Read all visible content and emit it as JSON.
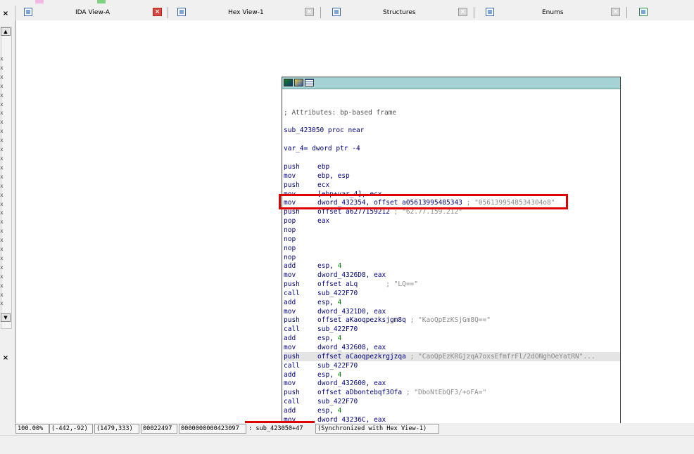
{
  "tabs": [
    {
      "label": "IDA View-A",
      "active": true
    },
    {
      "label": "Hex View-1",
      "active": false
    },
    {
      "label": "Structures",
      "active": false
    },
    {
      "label": "Enums",
      "active": false
    }
  ],
  "left_panel": {
    "close_glyph": "×",
    "scroll_up_glyph": "▲",
    "scroll_down_glyph": "▼",
    "x_markers": "x\nx\nx\nx\nx\nx\nx\nx\nx\nx\nx\nx\nx\nx\nx\nx\nx\nx\nx\nx\nx\nx\nx\nx\nx\nx\nx\nx"
  },
  "listing": {
    "attributes_comment": "; Attributes: bp-based frame",
    "proc_line": "sub_423050 proc near",
    "var_line": "var_4= dword ptr -4",
    "instructions": [
      {
        "m": "push",
        "o": "ebp",
        "c": ""
      },
      {
        "m": "mov",
        "o": "ebp, esp",
        "c": ""
      },
      {
        "m": "push",
        "o": "ecx",
        "c": ""
      },
      {
        "m": "mov",
        "o": "[ebp+var_4], ecx",
        "c": ""
      },
      {
        "m": "mov",
        "o": "dword_432354, offset a05613995485343",
        "c": " ; \"0561399548534304o8\""
      },
      {
        "m": "push",
        "o": "offset a6277159212",
        "c": " ; \"62.77.159.212\""
      },
      {
        "m": "pop",
        "o": "eax",
        "c": ""
      },
      {
        "m": "nop",
        "o": "",
        "c": ""
      },
      {
        "m": "nop",
        "o": "",
        "c": ""
      },
      {
        "m": "nop",
        "o": "",
        "c": ""
      },
      {
        "m": "nop",
        "o": "",
        "c": ""
      },
      {
        "m": "add",
        "o": "esp, 4",
        "c": ""
      },
      {
        "m": "mov",
        "o": "dword_4326D8, eax",
        "c": ""
      },
      {
        "m": "push",
        "o": "offset aLq",
        "c": "       ; \"LQ==\""
      },
      {
        "m": "call",
        "o": "sub_422F70",
        "c": ""
      },
      {
        "m": "add",
        "o": "esp, 4",
        "c": ""
      },
      {
        "m": "mov",
        "o": "dword_4321D0, eax",
        "c": ""
      },
      {
        "m": "push",
        "o": "offset aKaoqpezksjgm8q",
        "c": " ; \"KaoQpEzKSjGm8Q==\""
      },
      {
        "m": "call",
        "o": "sub_422F70",
        "c": ""
      },
      {
        "m": "add",
        "o": "esp, 4",
        "c": ""
      },
      {
        "m": "mov",
        "o": "dword_432608, eax",
        "c": ""
      },
      {
        "m": "push",
        "o": "offset aCaoqpezkrgjzqa",
        "c": " ; \"CaoQpEzKRGjzqA7oxsEfmfrFl/2dONghOeYatRN\"..."
      },
      {
        "m": "call",
        "o": "sub_422F70",
        "c": ""
      },
      {
        "m": "add",
        "o": "esp, 4",
        "c": ""
      },
      {
        "m": "mov",
        "o": "dword_432600, eax",
        "c": ""
      },
      {
        "m": "push",
        "o": "offset aDbontebqf3Ofa",
        "c": " ; \"DboNtEbQF3/+oFA=\""
      },
      {
        "m": "call",
        "o": "sub_422F70",
        "c": ""
      },
      {
        "m": "add",
        "o": "esp, 4",
        "c": ""
      },
      {
        "m": "mov",
        "o": "dword_43236C, eax",
        "c": ""
      }
    ]
  },
  "status_bar": {
    "zoom": "100.00%",
    "graph_pos": "(-442,-92)",
    "mouse_pos": "(1479,333)",
    "file_offset": "00022497",
    "address": "0000000000423097",
    "location": ": sub_423050+47",
    "sync": "(Synchronized with Hex View-1)"
  },
  "colors": {
    "node_header": "#a4d2d5",
    "highlight_box": "#e00000",
    "mnemonic": "#000080",
    "immediate": "#008000",
    "comment": "#8a8a8a"
  }
}
